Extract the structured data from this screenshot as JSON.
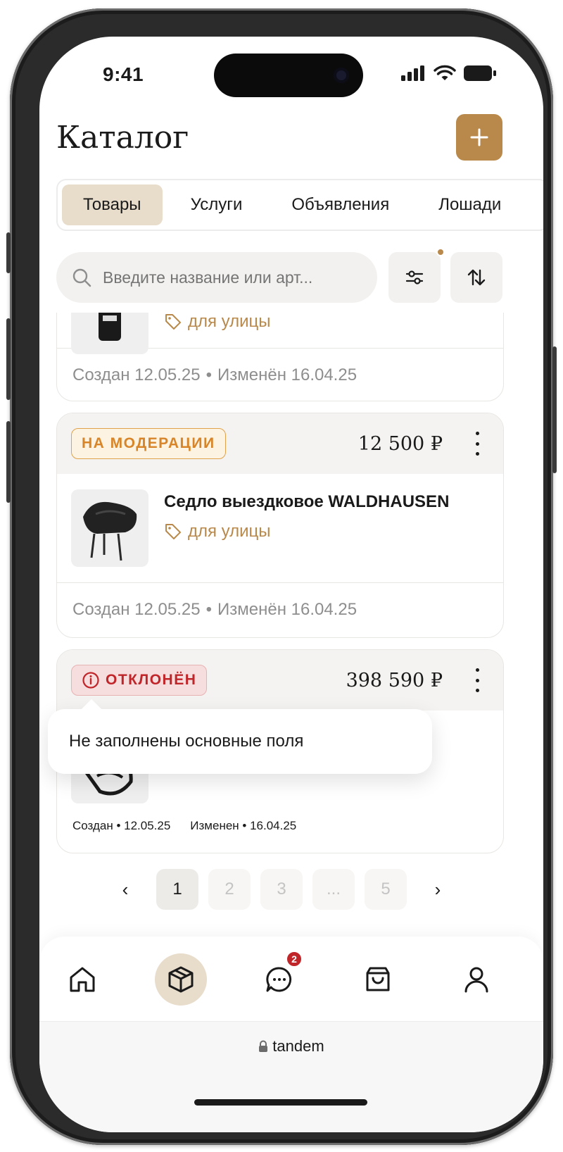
{
  "status_bar": {
    "time": "9:41"
  },
  "header": {
    "title": "Каталог",
    "add_icon": "plus-icon"
  },
  "tabs": [
    {
      "label": "Товары",
      "active": true
    },
    {
      "label": "Услуги",
      "active": false
    },
    {
      "label": "Объявления",
      "active": false
    },
    {
      "label": "Лошади",
      "active": false
    }
  ],
  "search": {
    "placeholder": "Введите название или арт...",
    "value": ""
  },
  "cards": [
    {
      "tag": "для улицы",
      "created": "Создан 12.05.25",
      "modified": "Изменён 16.04.25"
    },
    {
      "status": "НА МОДЕРАЦИИ",
      "price": "12 500 ₽",
      "title": "Седло выездковое WALDHAUSEN",
      "tag": "для улицы",
      "created": "Создан 12.05.25",
      "modified": "Изменён 16.04.25"
    },
    {
      "status": "ОТКЛОНЁН",
      "price": "398 590 ₽",
      "created_label": "Создан • 12.05.25",
      "modified_label": "Изменен • 16.04.25"
    }
  ],
  "tooltip": {
    "text": "Не заполнены основные поля"
  },
  "pagination": {
    "pages": [
      "1",
      "2",
      "3",
      "...",
      "5"
    ],
    "current": "1"
  },
  "bottom_nav": {
    "items": [
      "home-icon",
      "catalog-box-icon",
      "chat-icon",
      "bag-icon",
      "profile-icon"
    ],
    "active": "catalog-box-icon",
    "chat_badge": "2"
  },
  "browser": {
    "url": "tandem"
  },
  "colors": {
    "accent": "#b8894a",
    "accent_light": "#e8dccb",
    "warning": "#d8852a",
    "danger": "#c0252a"
  }
}
